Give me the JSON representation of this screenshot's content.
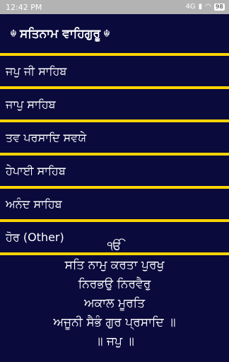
{
  "status_bar": {
    "time": "12:42 PM",
    "signal_badge": "4G",
    "battery": "98"
  },
  "app_bar": {
    "title": "ਸਤਿਨਾਮ ਵਾਹਿਗੁਰੂ",
    "emblem": "☬"
  },
  "menu": {
    "items": [
      {
        "label": "ਜਪੁ ਜੀ ਸਾਹਿਬ"
      },
      {
        "label": "ਜਾਪੁ  ਸਾਹਿਬ"
      },
      {
        "label": "ਤਵ ਪਰਸਾਦਿ ਸਵਯੇ"
      },
      {
        "label": "ਹੇਪਾਈ ਸਾਹਿਬ"
      },
      {
        "label": "ਅਨੰਦ ਸਾਹਿਬ"
      },
      {
        "label": "ਹੋਰ (Other)"
      }
    ]
  },
  "mool_mantar": {
    "lines": [
      "ੴ",
      "ਸਤਿ ਨਾਮੁ ਕਰਤਾ ਪੁਰਖੁ",
      "ਨਿਰਭਉ ਨਿਰਵੈਰੁ",
      "ਅਕਾਲ ਮੂਰਤਿ",
      "ਅਜੂਨੀ ਸੈਭੰ ਗੁਰ ਪ੍ਰਸਾਦਿ ॥",
      "॥ ਜਪੁ ॥"
    ]
  },
  "colors": {
    "background": "#0a0a3c",
    "divider": "#ffd400",
    "status_bar": "#b3b3b3",
    "text": "#ffffff"
  }
}
